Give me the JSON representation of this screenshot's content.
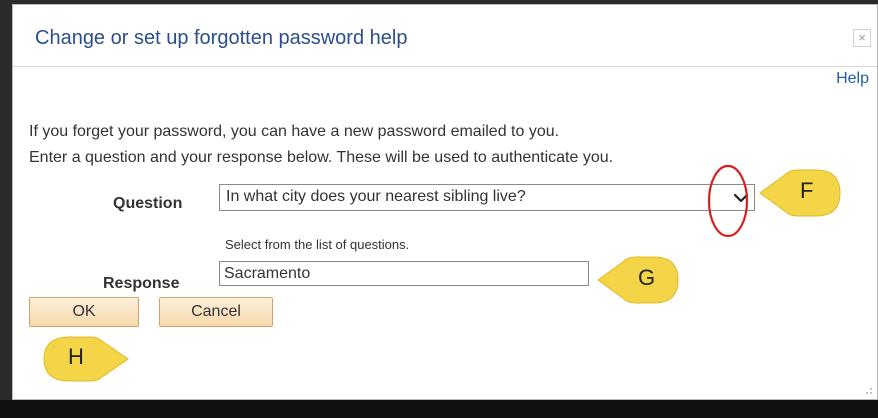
{
  "dialog": {
    "title": "Change or set up forgotten password help",
    "close_symbol": "×",
    "help_label": "Help"
  },
  "instructions": {
    "line1": "If you forget your password, you can have a new password emailed to you.",
    "line2": "Enter a question and your response below. These will be used to authenticate you."
  },
  "question": {
    "label": "Question",
    "selected": "In what city does your nearest sibling live?",
    "hint": "Select from the list of questions."
  },
  "response": {
    "label": "Response",
    "value": "Sacramento"
  },
  "buttons": {
    "ok_label": "OK",
    "cancel_label": "Cancel"
  },
  "callouts": {
    "f": "F",
    "g": "G",
    "h": "H"
  },
  "colors": {
    "title": "#2b4f8a",
    "callout_fill": "#f5d548",
    "highlight_ring": "#d62020",
    "button_fill": "#f8d8aa"
  }
}
